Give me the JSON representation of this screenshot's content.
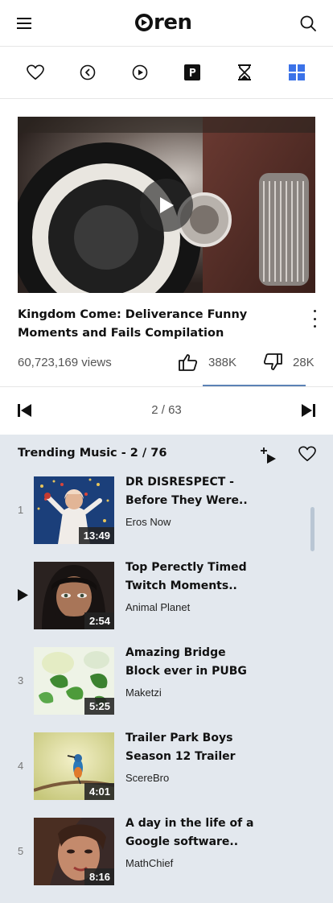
{
  "app": {
    "logo_text": "ren"
  },
  "toolbar_icons": [
    "heart-icon",
    "rewind-icon",
    "play-circle-icon",
    "parking-icon",
    "hourglass-icon",
    "grid-icon"
  ],
  "colors": {
    "accent": "#3b72e8",
    "playlist_bg": "#e3e8ee",
    "like_bar": "#5b82b5"
  },
  "video": {
    "title": "Kingdom Come: Deliverance Funny Moments and Fails Compilation",
    "views": "60,723,169 views",
    "likes": "388K",
    "dislikes": "28K"
  },
  "pager": {
    "count": "2 / 63"
  },
  "playlist": {
    "title": "Trending Music - 2 / 76",
    "items": [
      {
        "index": "1",
        "title": "DR DISRESPECT - Before They Were..",
        "channel": "Eros Now",
        "duration": "13:49",
        "playing": false
      },
      {
        "index": "2",
        "title": "Top Perectly Timed Twitch Moments..",
        "channel": "Animal Planet",
        "duration": "2:54",
        "playing": true
      },
      {
        "index": "3",
        "title": "Amazing Bridge Block ever in PUBG",
        "channel": "Maketzi",
        "duration": "5:25",
        "playing": false
      },
      {
        "index": "4",
        "title": "Trailer Park Boys Season 12 Trailer",
        "channel": "ScereBro",
        "duration": "4:01",
        "playing": false
      },
      {
        "index": "5",
        "title": "A day in the life of a Google software..",
        "channel": "MathChief",
        "duration": "8:16",
        "playing": false
      }
    ]
  }
}
